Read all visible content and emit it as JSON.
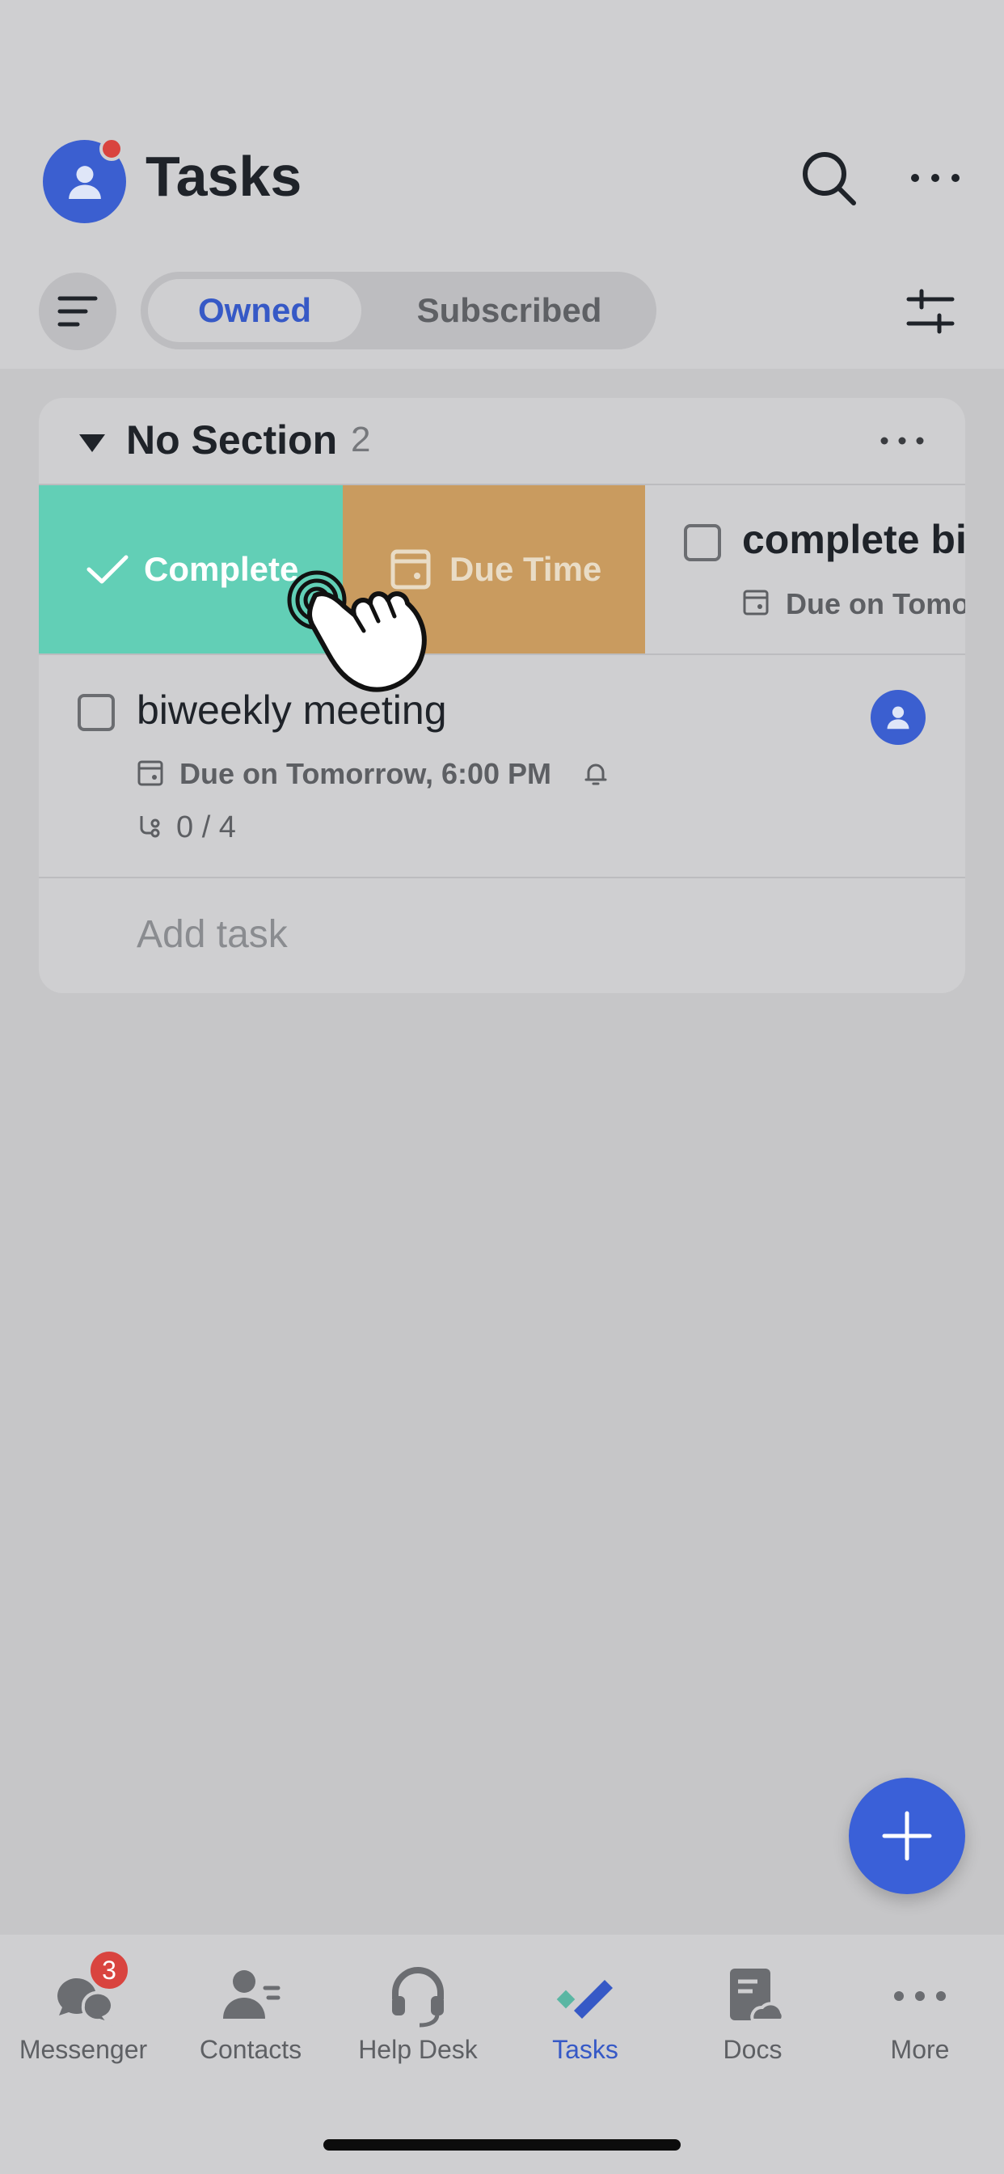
{
  "header": {
    "title": "Tasks",
    "tabs": [
      {
        "label": "Owned",
        "active": true
      },
      {
        "label": "Subscribed",
        "active": false
      }
    ]
  },
  "section": {
    "title": "No Section",
    "count": "2",
    "swipe_actions": {
      "complete_label": "Complete",
      "due_time_label": "Due Time"
    },
    "tasks": [
      {
        "title": "complete biweekly meeting",
        "due": "Due on Tomorrow"
      },
      {
        "title": "biweekly meeting",
        "due": "Due on Tomorrow, 6:00 PM",
        "subtasks": "0 / 4"
      }
    ],
    "add_task_label": "Add task"
  },
  "bottom_nav": {
    "items": [
      {
        "label": "Messenger",
        "badge": "3"
      },
      {
        "label": "Contacts"
      },
      {
        "label": "Help Desk"
      },
      {
        "label": "Tasks",
        "active": true
      },
      {
        "label": "Docs"
      },
      {
        "label": "More"
      }
    ]
  },
  "colors": {
    "accent": "#3659c6",
    "complete": "#62cfb6",
    "due_time": "#c99b5f",
    "badge": "#d9443f"
  }
}
